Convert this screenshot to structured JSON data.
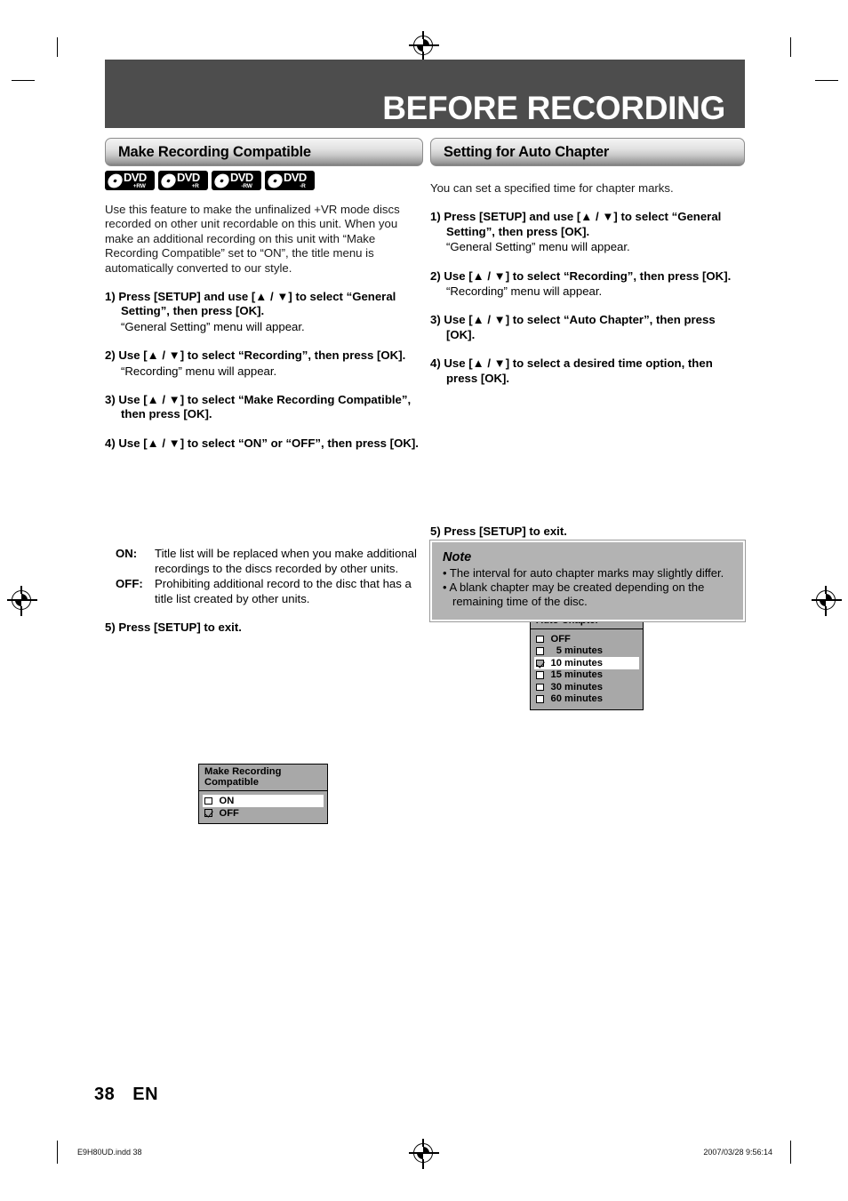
{
  "page": {
    "chapter_title": "BEFORE RECORDING",
    "page_number": "38",
    "language_code": "EN",
    "footer_file": "E9H80UD.indd   38",
    "footer_timestamp": "2007/03/28   9:56:14",
    "colors": {
      "title_bar": "#4d4d4d",
      "osd_background": "#a8a8a8",
      "note_background": "#b3b3b3",
      "selection_highlight": "#ffffff"
    }
  },
  "left_column": {
    "section_title": "Make Recording Compatible",
    "disc_logos": [
      {
        "name": "dvd-plus-rw-logo",
        "main": "DVD",
        "sub": "+RW"
      },
      {
        "name": "dvd-plus-r-logo",
        "main": "DVD",
        "sub": "+R"
      },
      {
        "name": "dvd-minus-rw-logo",
        "main": "DVD",
        "sub": "-RW"
      },
      {
        "name": "dvd-minus-r-logo",
        "main": "DVD",
        "sub": "-R"
      }
    ],
    "intro": "Use this feature to make the unfinalized +VR mode discs recorded on other unit recordable on this unit. When you make an additional recording on this unit with “Make Recording Compatible” set to “ON”, the title menu is automatically converted to our style.",
    "steps": [
      {
        "label": "1) Press [SETUP] and use [▲ / ▼] to select “General Setting”, then press [OK].",
        "note": "“General Setting” menu will appear."
      },
      {
        "label": "2) Use [▲ / ▼] to select “Recording”, then press [OK].",
        "note": "“Recording” menu will appear."
      },
      {
        "label": "3) Use [▲ / ▼] to select “Make Recording Compatible”, then press [OK].",
        "note": ""
      },
      {
        "label": "4) Use [▲ / ▼] to select “ON” or “OFF”, then press [OK].",
        "note": ""
      },
      {
        "label": "5) Press [SETUP] to exit.",
        "note": ""
      }
    ],
    "osd_menu": {
      "title": "Make Recording Compatible",
      "options": [
        {
          "label": "ON",
          "checked": false,
          "selected": true
        },
        {
          "label": "OFF",
          "checked": true,
          "selected": false
        }
      ]
    },
    "definitions": [
      {
        "term": "ON:",
        "description": "Title list will be replaced when you make additional recordings to the discs recorded by other units."
      },
      {
        "term": "OFF:",
        "description": "Prohibiting additional record to the disc that has a title list created by other units."
      }
    ]
  },
  "right_column": {
    "section_title": "Setting for Auto Chapter",
    "intro": "You can set a specified time for chapter marks.",
    "steps": [
      {
        "label": "1) Press [SETUP] and use [▲ / ▼] to select “General Setting”, then press [OK].",
        "note": "“General Setting” menu will appear."
      },
      {
        "label": "2) Use [▲ / ▼] to select “Recording”, then press [OK].",
        "note": "“Recording” menu will appear."
      },
      {
        "label": "3) Use [▲ / ▼] to select “Auto Chapter”, then press [OK].",
        "note": ""
      },
      {
        "label": "4) Use [▲ / ▼] to select a desired time option, then press [OK].",
        "note": ""
      },
      {
        "label": "5) Press [SETUP] to exit.",
        "note": ""
      }
    ],
    "osd_menu": {
      "title": "Auto Chapter",
      "options": [
        {
          "label": "OFF",
          "checked": false,
          "selected": false
        },
        {
          "label": "  5 minutes",
          "checked": false,
          "selected": false
        },
        {
          "label": "10 minutes",
          "checked": true,
          "selected": true
        },
        {
          "label": "15 minutes",
          "checked": false,
          "selected": false
        },
        {
          "label": "30 minutes",
          "checked": false,
          "selected": false
        },
        {
          "label": "60 minutes",
          "checked": false,
          "selected": false
        }
      ]
    },
    "note": {
      "title": "Note",
      "items": [
        "• The interval for auto chapter marks may slightly differ.",
        "• A blank chapter may be created depending on the remaining time of the disc."
      ]
    }
  }
}
